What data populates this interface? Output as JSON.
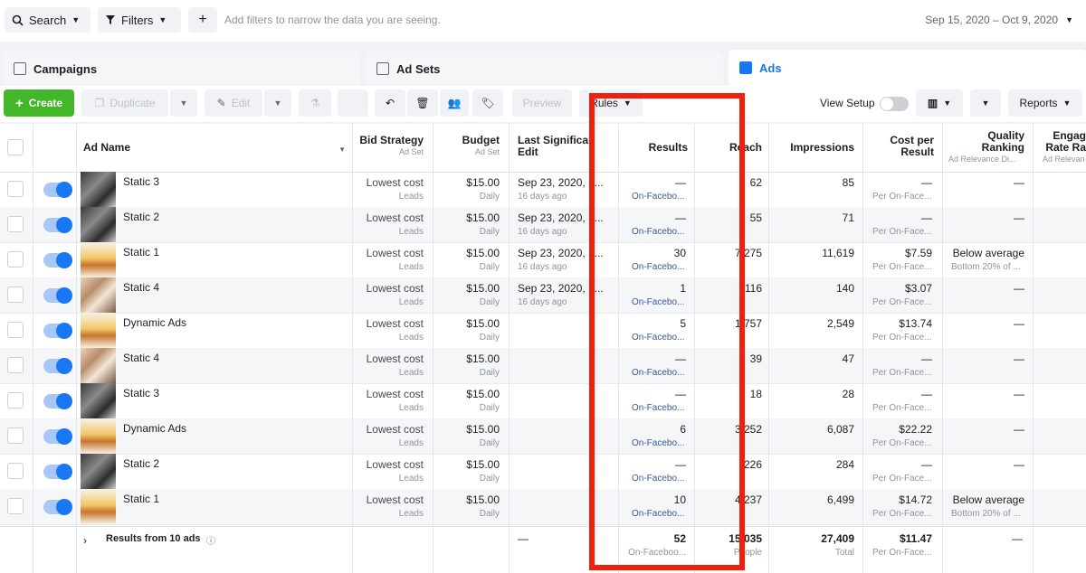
{
  "filterbar": {
    "search_label": "Search",
    "filters_label": "Filters",
    "add_icon": "plus-icon",
    "hint": "Add filters to narrow the data you are seeing.",
    "date_range": "Sep 15, 2020 – Oct 9, 2020"
  },
  "tabs": [
    {
      "label": "Campaigns",
      "icon": "folder-icon"
    },
    {
      "label": "Ad Sets",
      "icon": "grid-icon"
    },
    {
      "label": "Ads",
      "icon": "ad-icon"
    }
  ],
  "toolbar": {
    "create": "Create",
    "duplicate": "Duplicate",
    "edit": "Edit",
    "preview": "Preview",
    "rules": "Rules",
    "view_setup": "View Setup",
    "reports": "Reports"
  },
  "columns": {
    "ad_name": "Ad Name",
    "bid_strategy": "Bid Strategy",
    "bid_strategy_sub": "Ad Set",
    "budget": "Budget",
    "budget_sub": "Ad Set",
    "last_edit_1": "Last Significan",
    "last_edit_2": "Edit",
    "results": "Results",
    "reach": "Reach",
    "impressions": "Impressions",
    "cost_1": "Cost per",
    "cost_2": "Result",
    "quality_1": "Quality",
    "quality_2": "Ranking",
    "quality_sub": "Ad Relevance Di...",
    "engage_1": "Engag",
    "engage_2": "Rate Ra",
    "engage_sub": "Ad Relevan"
  },
  "rows": [
    {
      "name": "Static 3",
      "bid": "Lowest cost",
      "bid_sub": "Leads",
      "budget": "$15.00",
      "budget_sub": "Daily",
      "edit": "Sep 23, 2020, 3...",
      "edit_sub": "16 days ago",
      "results": "—",
      "results_sub": "On-Facebo...",
      "reach": "62",
      "impressions": "85",
      "cost": "—",
      "cost_sub": "Per On-Face...",
      "quality": "—",
      "quality_sub": ""
    },
    {
      "name": "Static 2",
      "bid": "Lowest cost",
      "bid_sub": "Leads",
      "budget": "$15.00",
      "budget_sub": "Daily",
      "edit": "Sep 23, 2020, 3...",
      "edit_sub": "16 days ago",
      "results": "—",
      "results_sub": "On-Facebo...",
      "reach": "55",
      "impressions": "71",
      "cost": "—",
      "cost_sub": "Per On-Face...",
      "quality": "—",
      "quality_sub": ""
    },
    {
      "name": "Static 1",
      "bid": "Lowest cost",
      "bid_sub": "Leads",
      "budget": "$15.00",
      "budget_sub": "Daily",
      "edit": "Sep 23, 2020, 3...",
      "edit_sub": "16 days ago",
      "results": "30",
      "results_sub": "On-Facebo...",
      "reach": "7,275",
      "impressions": "11,619",
      "cost": "$7.59",
      "cost_sub": "Per On-Face...",
      "quality": "Below average",
      "quality_sub": "Bottom 20% of ..."
    },
    {
      "name": "Static 4",
      "bid": "Lowest cost",
      "bid_sub": "Leads",
      "budget": "$15.00",
      "budget_sub": "Daily",
      "edit": "Sep 23, 2020, 3...",
      "edit_sub": "16 days ago",
      "results": "1",
      "results_sub": "On-Facebo...",
      "reach": "116",
      "impressions": "140",
      "cost": "$3.07",
      "cost_sub": "Per On-Face...",
      "quality": "—",
      "quality_sub": ""
    },
    {
      "name": "Dynamic Ads",
      "bid": "Lowest cost",
      "bid_sub": "Leads",
      "budget": "$15.00",
      "budget_sub": "Daily",
      "edit": "",
      "edit_sub": "",
      "results": "5",
      "results_sub": "On-Facebo...",
      "reach": "1,757",
      "impressions": "2,549",
      "cost": "$13.74",
      "cost_sub": "Per On-Face...",
      "quality": "—",
      "quality_sub": ""
    },
    {
      "name": "Static 4",
      "bid": "Lowest cost",
      "bid_sub": "Leads",
      "budget": "$15.00",
      "budget_sub": "Daily",
      "edit": "",
      "edit_sub": "",
      "results": "—",
      "results_sub": "On-Facebo...",
      "reach": "39",
      "impressions": "47",
      "cost": "—",
      "cost_sub": "Per On-Face...",
      "quality": "—",
      "quality_sub": ""
    },
    {
      "name": "Static 3",
      "bid": "Lowest cost",
      "bid_sub": "Leads",
      "budget": "$15.00",
      "budget_sub": "Daily",
      "edit": "",
      "edit_sub": "",
      "results": "—",
      "results_sub": "On-Facebo...",
      "reach": "18",
      "impressions": "28",
      "cost": "—",
      "cost_sub": "Per On-Face...",
      "quality": "—",
      "quality_sub": ""
    },
    {
      "name": "Dynamic Ads",
      "bid": "Lowest cost",
      "bid_sub": "Leads",
      "budget": "$15.00",
      "budget_sub": "Daily",
      "edit": "",
      "edit_sub": "",
      "results": "6",
      "results_sub": "On-Facebo...",
      "reach": "3,252",
      "impressions": "6,087",
      "cost": "$22.22",
      "cost_sub": "Per On-Face...",
      "quality": "—",
      "quality_sub": ""
    },
    {
      "name": "Static 2",
      "bid": "Lowest cost",
      "bid_sub": "Leads",
      "budget": "$15.00",
      "budget_sub": "Daily",
      "edit": "",
      "edit_sub": "",
      "results": "—",
      "results_sub": "On-Facebo...",
      "reach": "226",
      "impressions": "284",
      "cost": "—",
      "cost_sub": "Per On-Face...",
      "quality": "—",
      "quality_sub": ""
    },
    {
      "name": "Static 1",
      "bid": "Lowest cost",
      "bid_sub": "Leads",
      "budget": "$15.00",
      "budget_sub": "Daily",
      "edit": "",
      "edit_sub": "",
      "results": "10",
      "results_sub": "On-Facebo...",
      "reach": "4,237",
      "impressions": "6,499",
      "cost": "$14.72",
      "cost_sub": "Per On-Face...",
      "quality": "Below average",
      "quality_sub": "Bottom 20% of ..."
    }
  ],
  "summary": {
    "label": "Results from 10 ads",
    "edit": "—",
    "results": "52",
    "results_sub": "On-Faceboo...",
    "reach": "15,035",
    "reach_sub": "People",
    "impressions": "27,409",
    "impressions_sub": "Total",
    "cost": "$11.47",
    "cost_sub": "Per On-Face...",
    "quality": "—"
  },
  "colors": {
    "accent": "#1877f2",
    "create_green": "#42b72a",
    "highlight_red": "#f0200c"
  }
}
